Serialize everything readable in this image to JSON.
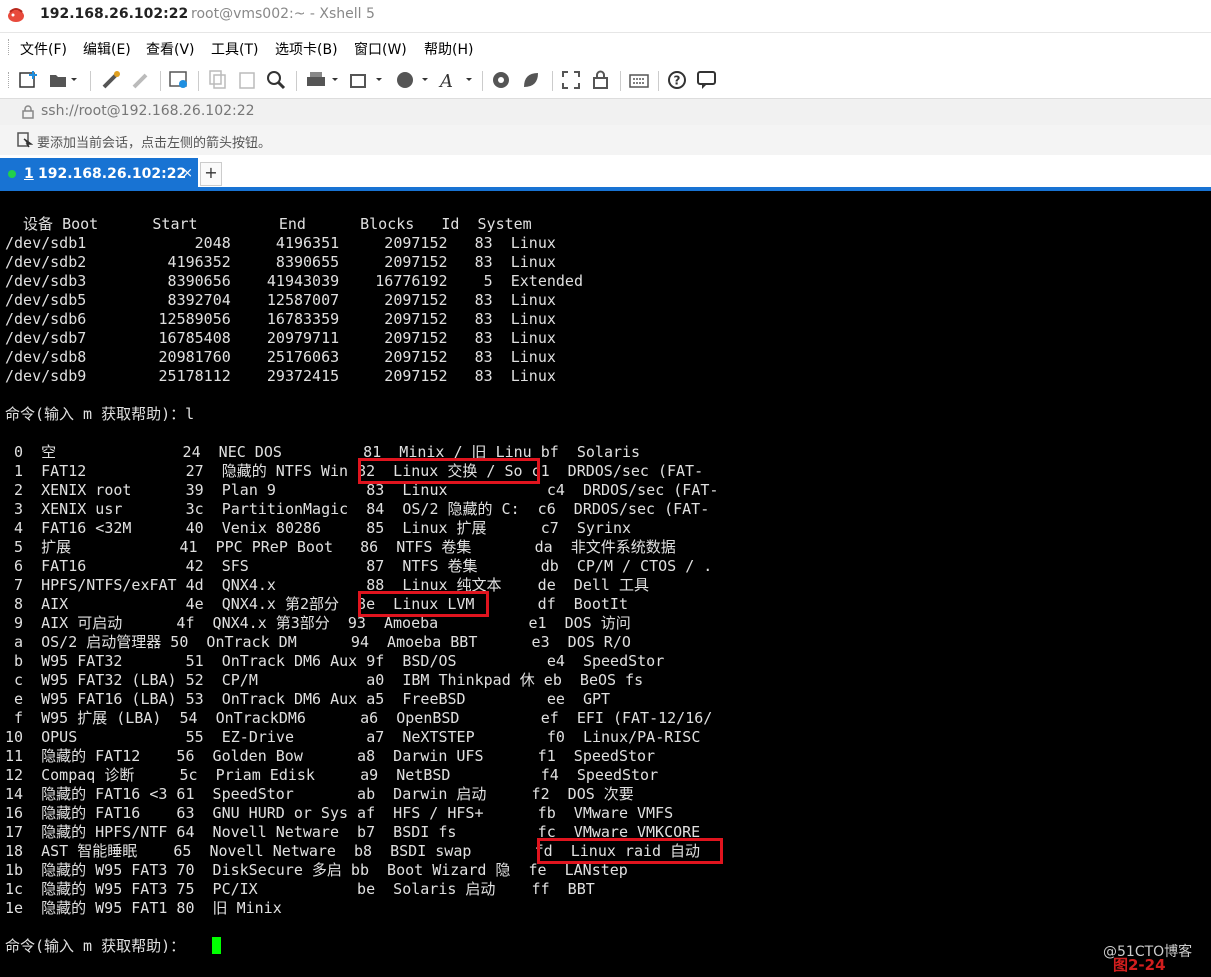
{
  "window": {
    "title_host": "192.168.26.102:22",
    "title_rest": "root@vms002:~ - Xshell 5"
  },
  "menu": [
    "文件(F)",
    "编辑(E)",
    "查看(V)",
    "工具(T)",
    "选项卡(B)",
    "窗口(W)",
    "帮助(H)"
  ],
  "address": {
    "url": "ssh://root@192.168.26.102:22"
  },
  "hint": "要添加当前会话，点击左侧的箭头按钮。",
  "tab": {
    "number": "1",
    "label": " 192.168.26.102:22",
    "close": "×",
    "add": "+"
  },
  "terminal": {
    "lines": [
      "  设备 Boot      Start         End      Blocks   Id  System",
      "/dev/sdb1            2048     4196351     2097152   83  Linux",
      "/dev/sdb2         4196352     8390655     2097152   83  Linux",
      "/dev/sdb3         8390656    41943039    16776192    5  Extended",
      "/dev/sdb5         8392704    12587007     2097152   83  Linux",
      "/dev/sdb6        12589056    16783359     2097152   83  Linux",
      "/dev/sdb7        16785408    20979711     2097152   83  Linux",
      "/dev/sdb8        20981760    25176063     2097152   83  Linux",
      "/dev/sdb9        25178112    29372415     2097152   83  Linux",
      "",
      "命令(输入 m 获取帮助)：l",
      "",
      " 0  空              24  NEC DOS         81  Minix / 旧 Linu bf  Solaris",
      " 1  FAT12           27  隐藏的 NTFS Win 82  Linux 交换 / So c1  DRDOS/sec (FAT-",
      " 2  XENIX root      39  Plan 9          83  Linux           c4  DRDOS/sec (FAT-",
      " 3  XENIX usr       3c  PartitionMagic  84  OS/2 隐藏的 C:  c6  DRDOS/sec (FAT-",
      " 4  FAT16 <32M      40  Venix 80286     85  Linux 扩展      c7  Syrinx",
      " 5  扩展            41  PPC PReP Boot   86  NTFS 卷集       da  非文件系统数据",
      " 6  FAT16           42  SFS             87  NTFS 卷集       db  CP/M / CTOS / .",
      " 7  HPFS/NTFS/exFAT 4d  QNX4.x          88  Linux 纯文本    de  Dell 工具",
      " 8  AIX             4e  QNX4.x 第2部分  8e  Linux LVM       df  BootIt",
      " 9  AIX 可启动      4f  QNX4.x 第3部分  93  Amoeba          e1  DOS 访问",
      " a  OS/2 启动管理器 50  OnTrack DM      94  Amoeba BBT      e3  DOS R/O",
      " b  W95 FAT32       51  OnTrack DM6 Aux 9f  BSD/OS          e4  SpeedStor",
      " c  W95 FAT32 (LBA) 52  CP/M            a0  IBM Thinkpad 休 eb  BeOS fs",
      " e  W95 FAT16 (LBA) 53  OnTrack DM6 Aux a5  FreeBSD         ee  GPT",
      " f  W95 扩展 (LBA)  54  OnTrackDM6      a6  OpenBSD         ef  EFI (FAT-12/16/",
      "10  OPUS            55  EZ-Drive        a7  NeXTSTEP        f0  Linux/PA-RISC",
      "11  隐藏的 FAT12    56  Golden Bow      a8  Darwin UFS      f1  SpeedStor",
      "12  Compaq 诊断     5c  Priam Edisk     a9  NetBSD          f4  SpeedStor",
      "14  隐藏的 FAT16 <3 61  SpeedStor       ab  Darwin 启动     f2  DOS 次要",
      "16  隐藏的 FAT16    63  GNU HURD or Sys af  HFS / HFS+      fb  VMware VMFS",
      "17  隐藏的 HPFS/NTF 64  Novell Netware  b7  BSDI fs         fc  VMware VMKCORE",
      "18  AST 智能睡眠    65  Novell Netware  b8  BSDI swap       fd  Linux raid 自动",
      "1b  隐藏的 W95 FAT3 70  DiskSecure 多启 bb  Boot Wizard 隐  fe  LANstep",
      "1c  隐藏的 W95 FAT3 75  PC/IX           be  Solaris 启动    ff  BBT",
      "1e  隐藏的 W95 FAT1 80  旧 Minix",
      "",
      "命令(输入 m 获取帮助)："
    ]
  },
  "watermark": {
    "site": "@51CTO博客",
    "figure": "图2-24"
  },
  "colors": {
    "tab_blue": "#1873d3",
    "highlight_red": "#e0141e",
    "cursor_green": "#00ff00",
    "terminal_bg": "#000000"
  }
}
